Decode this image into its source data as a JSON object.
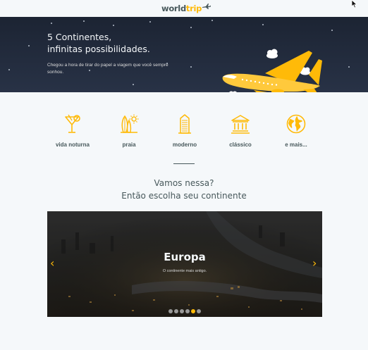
{
  "header": {
    "logo_part1": "world",
    "logo_part2": "trip"
  },
  "banner": {
    "title_line1": "5 Continentes,",
    "title_line2": "infinitas possibilidades.",
    "subtitle": "Chegou a hora de tirar do papel a viagem que você sempre sonhou."
  },
  "travel_types": [
    {
      "label": "vida noturna",
      "icon": "cocktail-icon"
    },
    {
      "label": "praia",
      "icon": "surfboard-icon"
    },
    {
      "label": "moderno",
      "icon": "building-icon"
    },
    {
      "label": "clássico",
      "icon": "museum-icon"
    },
    {
      "label": "e mais...",
      "icon": "globe-icon"
    }
  ],
  "section": {
    "heading_line1": "Vamos nessa?",
    "heading_line2": "Então escolha seu continente"
  },
  "slider": {
    "title": "Europa",
    "subtitle": "O continente mais antigo.",
    "total_slides": 6,
    "active_slide": 5
  },
  "colors": {
    "accent": "#ffba08",
    "text": "#47585b",
    "banner_bg": "#1c2433"
  }
}
